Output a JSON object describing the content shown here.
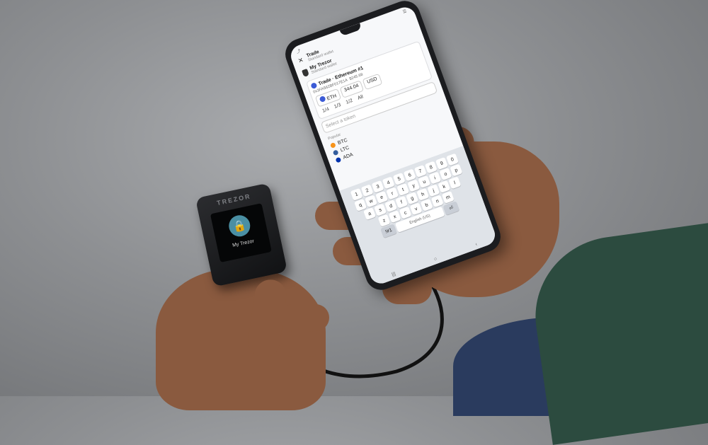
{
  "phone": {
    "app_title": "Trade",
    "app_subtitle": "Standard wallet",
    "wallet_name": "My Trezor",
    "wallet_type": "Standard wallet",
    "trade_title": "Trade · Ethereum #1",
    "address": "0x3FA562BF017E1A",
    "amount_fiat": "$245.68",
    "from_coin": "ETH",
    "amount": "344.04",
    "currency": "USD",
    "percent_options": [
      "1/4",
      "1/3",
      "1/2",
      "All"
    ],
    "select_placeholder": "Select a token",
    "options_header": "Popular",
    "options": [
      "BTC",
      "LTC",
      "ADA"
    ],
    "keyboard_rows": [
      [
        "1",
        "2",
        "3",
        "4",
        "5",
        "6",
        "7",
        "8",
        "9",
        "0"
      ],
      [
        "q",
        "w",
        "e",
        "r",
        "t",
        "y",
        "u",
        "i",
        "o",
        "p"
      ],
      [
        "a",
        "s",
        "d",
        "f",
        "g",
        "h",
        "j",
        "k",
        "l"
      ],
      [
        "z",
        "x",
        "c",
        "v",
        "b",
        "n",
        "m"
      ]
    ],
    "space_label": "English (US)",
    "symbols_key": "!#1"
  },
  "trezor": {
    "brand": "TREZOR",
    "screen_label": "My Trezor",
    "icon": "lock-icon"
  },
  "colors": {
    "background": "#8d8f92",
    "lock_circle": "#4a8fa3",
    "sleeve": "#2c4b3f",
    "skin": "#8a5a3f"
  }
}
